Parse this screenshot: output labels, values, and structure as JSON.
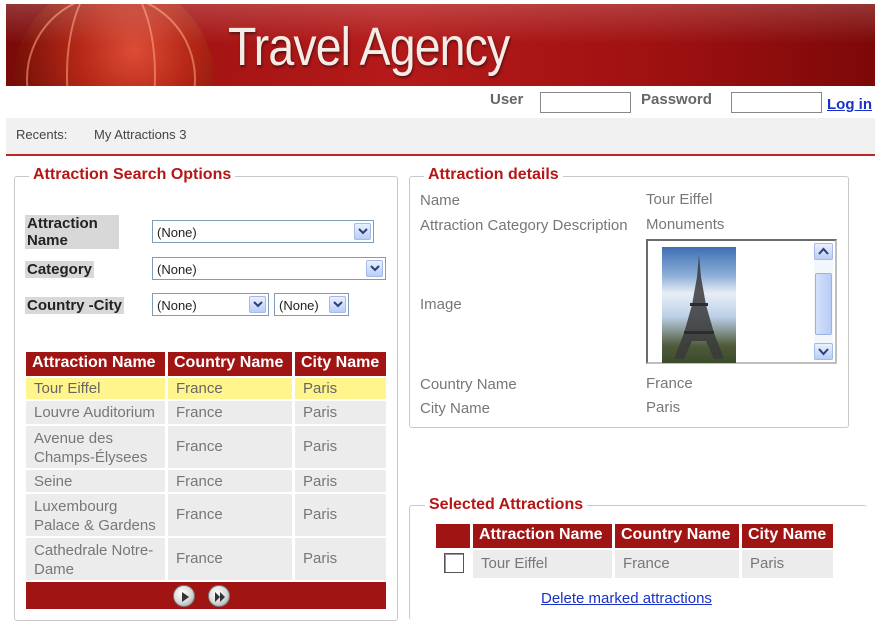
{
  "header": {
    "title": "Travel Agency"
  },
  "login": {
    "user_label": "User",
    "user_value": "",
    "password_label": "Password",
    "password_value": "",
    "login_link": "Log in"
  },
  "recents": {
    "label": "Recents:",
    "item": "My Attractions 3"
  },
  "search": {
    "legend": "Attraction Search Options",
    "attraction_name_label": "Attraction Name",
    "attraction_name_value": "(None)",
    "category_label": "Category",
    "category_value": "(None)",
    "country_city_label": "Country -City",
    "country_value": "(None)",
    "city_value": "(None)",
    "columns": [
      "Attraction Name",
      "Country Name",
      "City Name"
    ],
    "rows": [
      {
        "attraction": "Tour Eiffel",
        "country": "France",
        "city": "Paris",
        "selected": true
      },
      {
        "attraction": "Louvre Auditorium",
        "country": "France",
        "city": "Paris"
      },
      {
        "attraction": "Avenue des Champs-Élysees",
        "country": "France",
        "city": "Paris"
      },
      {
        "attraction": "Seine",
        "country": "France",
        "city": "Paris"
      },
      {
        "attraction": "Luxembourg Palace & Gardens",
        "country": "France",
        "city": "Paris"
      },
      {
        "attraction": "Cathedrale Notre-Dame",
        "country": "France",
        "city": "Paris"
      }
    ]
  },
  "details": {
    "legend": "Attraction details",
    "name_label": "Name",
    "name_value": "Tour Eiffel",
    "category_label": "Attraction Category Description",
    "category_value": "Monuments",
    "image_label": "Image",
    "country_label": "Country Name",
    "country_value": "France",
    "city_label": "City Name",
    "city_value": "Paris"
  },
  "selected": {
    "legend": "Selected Attractions",
    "columns": [
      "Attraction Name",
      "Country Name",
      "City Name"
    ],
    "rows": [
      {
        "attraction": "Tour Eiffel",
        "country": "France",
        "city": "Paris",
        "checked": false
      }
    ],
    "delete_link": "Delete marked attractions"
  },
  "colors": {
    "brand": "#a01414",
    "highlight": "#fff58c",
    "link": "#1a31c8"
  }
}
